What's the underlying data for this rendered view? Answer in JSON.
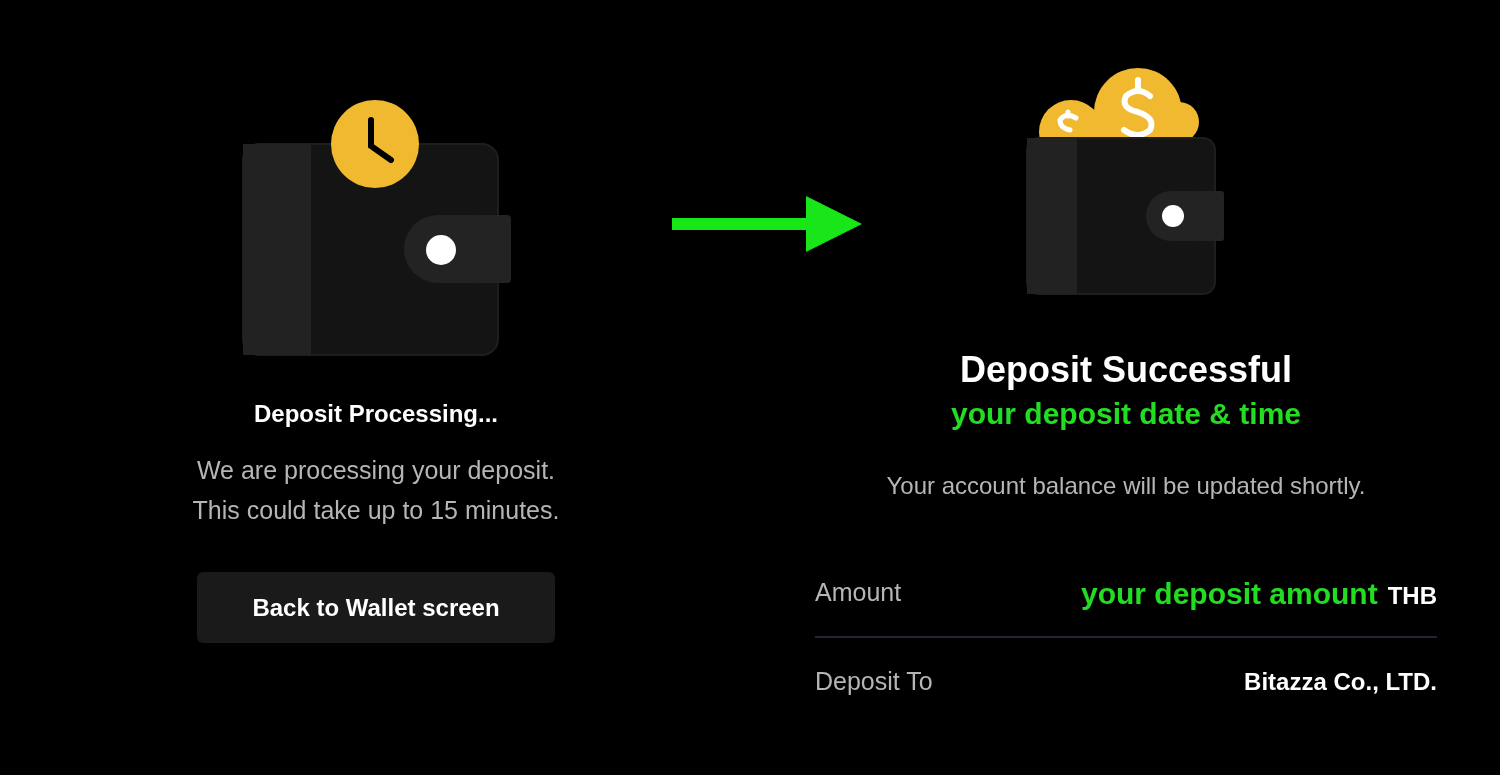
{
  "processing": {
    "title": "Deposit Processing...",
    "message_lines": [
      "We are processing your deposit.",
      "This could take up to 15 minutes."
    ],
    "button": "Back to Wallet screen"
  },
  "success": {
    "title": "Deposit Successful",
    "date_time": "your deposit date & time",
    "message": "Your account balance will be updated shortly.",
    "details": [
      {
        "label": "Amount",
        "value": "your deposit amount",
        "highlight": true,
        "unit": "THB"
      },
      {
        "label": "Deposit To",
        "value": "Bitazza Co., LTD.",
        "highlight": false
      }
    ]
  }
}
